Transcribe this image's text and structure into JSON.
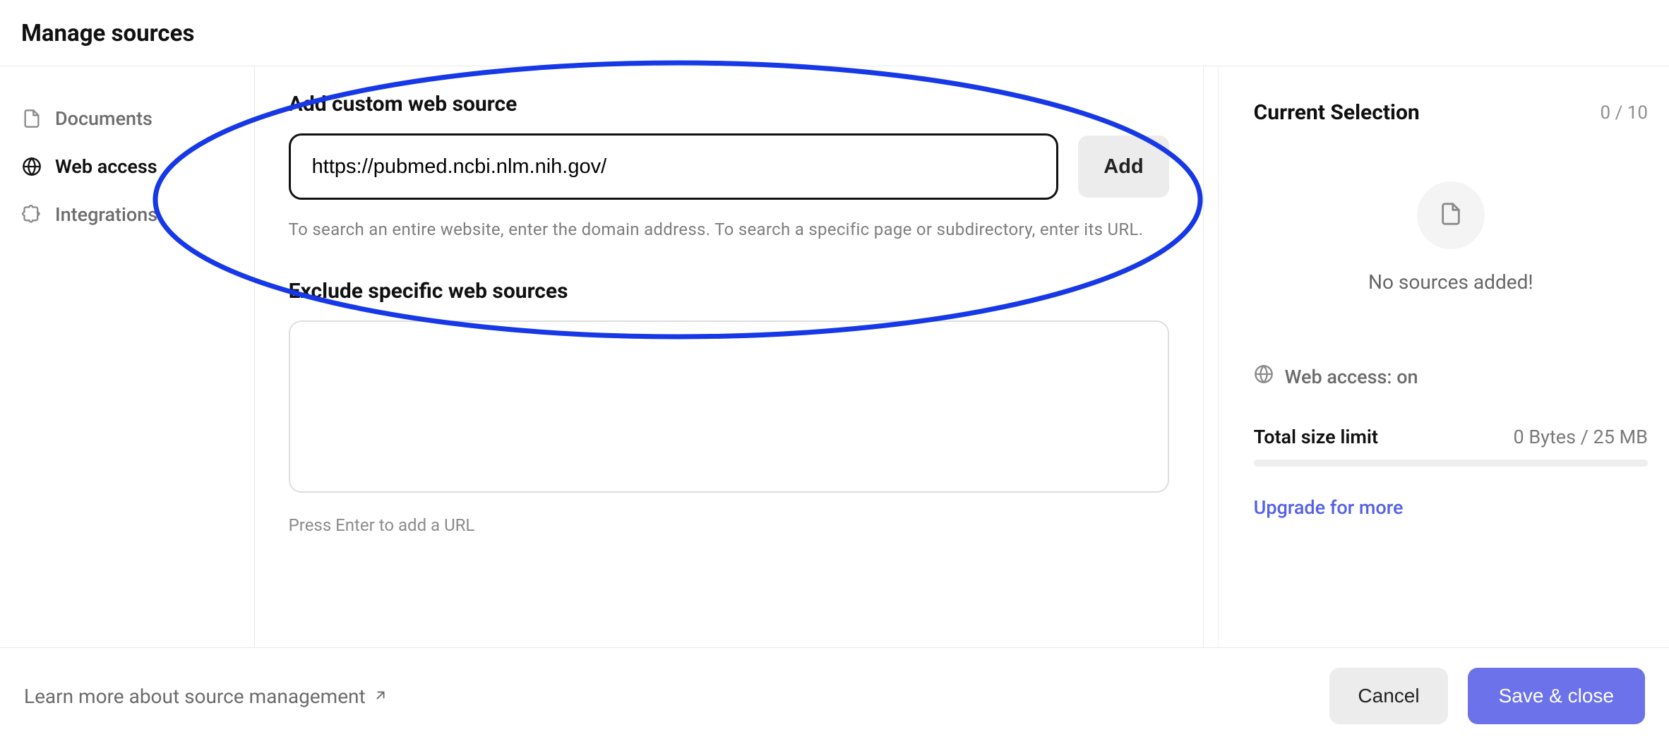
{
  "header": {
    "title": "Manage sources"
  },
  "sidebar": {
    "items": [
      {
        "label": "Documents",
        "active": false
      },
      {
        "label": "Web access",
        "active": true
      },
      {
        "label": "Integrations",
        "active": false
      }
    ]
  },
  "main": {
    "add_section_title": "Add custom web source",
    "url_value": "https://pubmed.ncbi.nlm.nih.gov/",
    "add_button": "Add",
    "help_text": "To search an entire website, enter the domain address. To search a specific page or subdirectory, enter its URL.",
    "exclude_section_title": "Exclude specific web sources",
    "exclude_value": "",
    "exclude_hint": "Press Enter to add a URL"
  },
  "right": {
    "title": "Current Selection",
    "count": "0 / 10",
    "empty_text": "No sources added!",
    "web_access_label": "Web access: on",
    "limit_label": "Total size limit",
    "limit_value": "0 Bytes / 25 MB",
    "upgrade_label": "Upgrade for more"
  },
  "footer": {
    "learn_more": "Learn more about source management",
    "cancel": "Cancel",
    "save": "Save & close"
  }
}
